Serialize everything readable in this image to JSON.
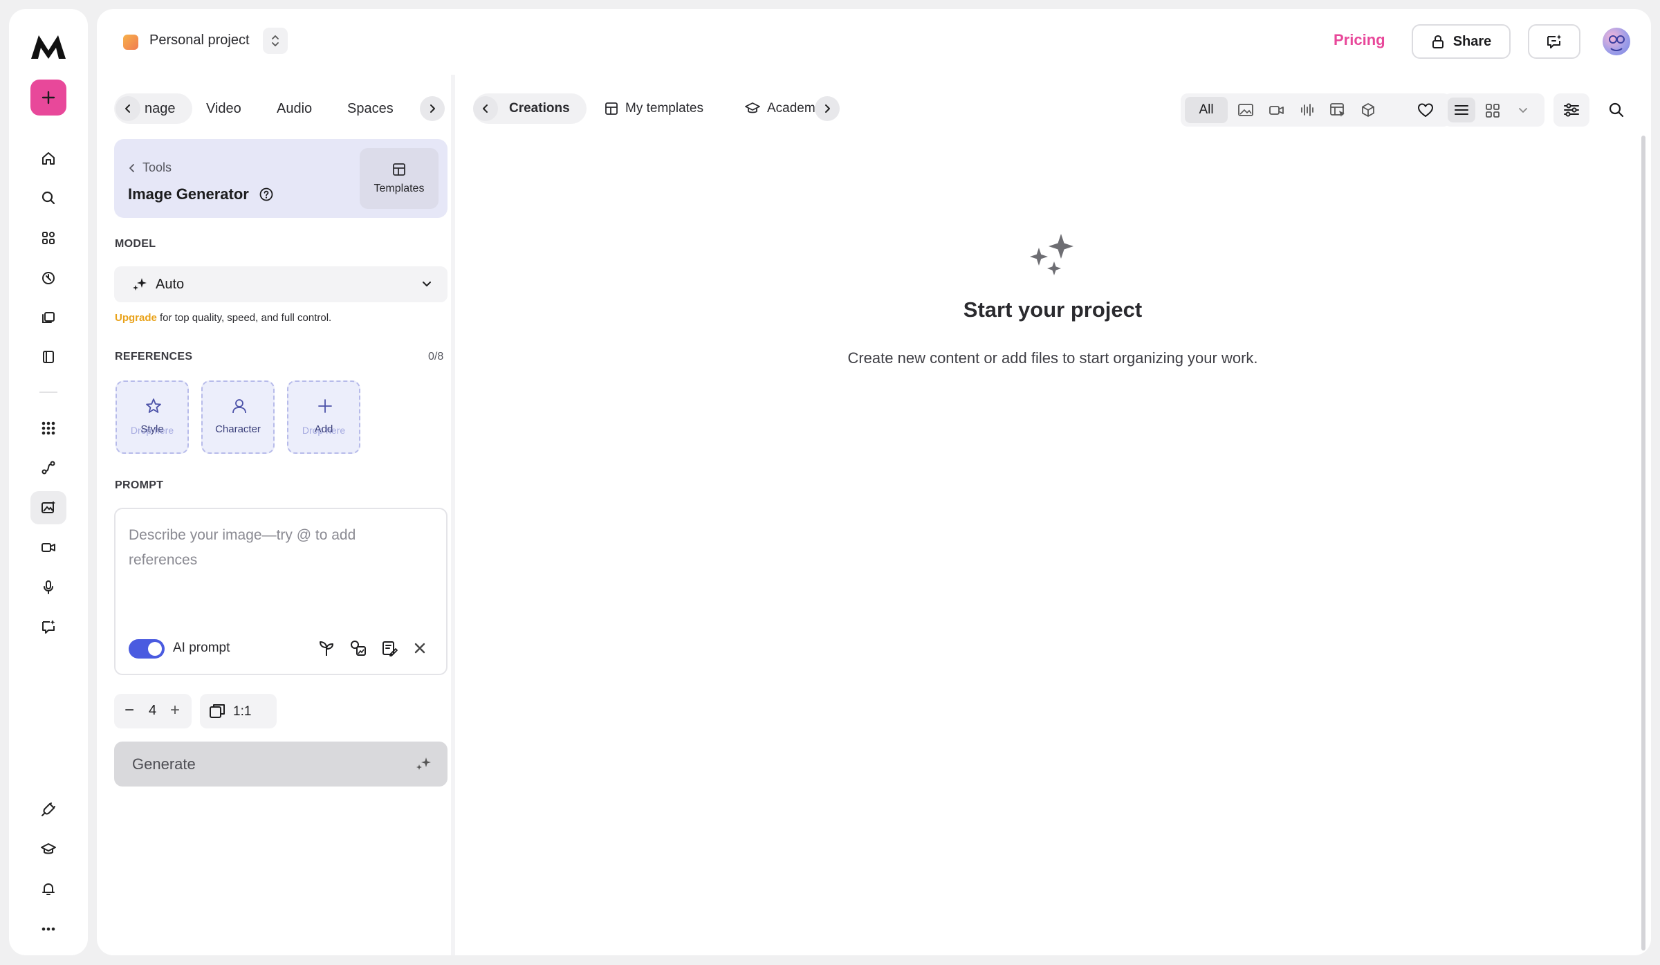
{
  "header": {
    "project_name": "Personal project",
    "pricing": "Pricing",
    "share": "Share"
  },
  "categories": {
    "tabs": [
      {
        "label": "nage"
      },
      {
        "label": "Video"
      },
      {
        "label": "Audio"
      },
      {
        "label": "Spaces"
      }
    ]
  },
  "tool": {
    "back": "Tools",
    "title": "Image Generator",
    "templates": "Templates"
  },
  "model": {
    "section": "MODEL",
    "value": "Auto",
    "upgrade_link": "Upgrade",
    "upgrade_text": " for top quality, speed, and full control."
  },
  "references": {
    "section": "REFERENCES",
    "count": "0/8",
    "items": [
      {
        "label": "Style",
        "hint": "Drop here"
      },
      {
        "label": "Character",
        "hint": ""
      },
      {
        "label": "Add",
        "hint": "Drop here"
      }
    ]
  },
  "prompt": {
    "section": "PROMPT",
    "placeholder": "Describe your image—try @ to add references",
    "ai_prompt": "AI prompt",
    "ai_prompt_on": true
  },
  "settings": {
    "count": "4",
    "ratio": "1:1"
  },
  "generate": {
    "label": "Generate"
  },
  "views": {
    "tabs": [
      {
        "label": "Creations"
      },
      {
        "label": "My templates"
      },
      {
        "label": "Academ"
      }
    ]
  },
  "filters": {
    "all": "All"
  },
  "empty_state": {
    "title": "Start your project",
    "subtitle": "Create new content or add files to start organizing your work."
  },
  "colors": {
    "accent_pink": "#e8489a",
    "toggle_blue": "#4a5be0",
    "upgrade_orange": "#e9a21a",
    "tool_card": "#e6e7f7"
  }
}
